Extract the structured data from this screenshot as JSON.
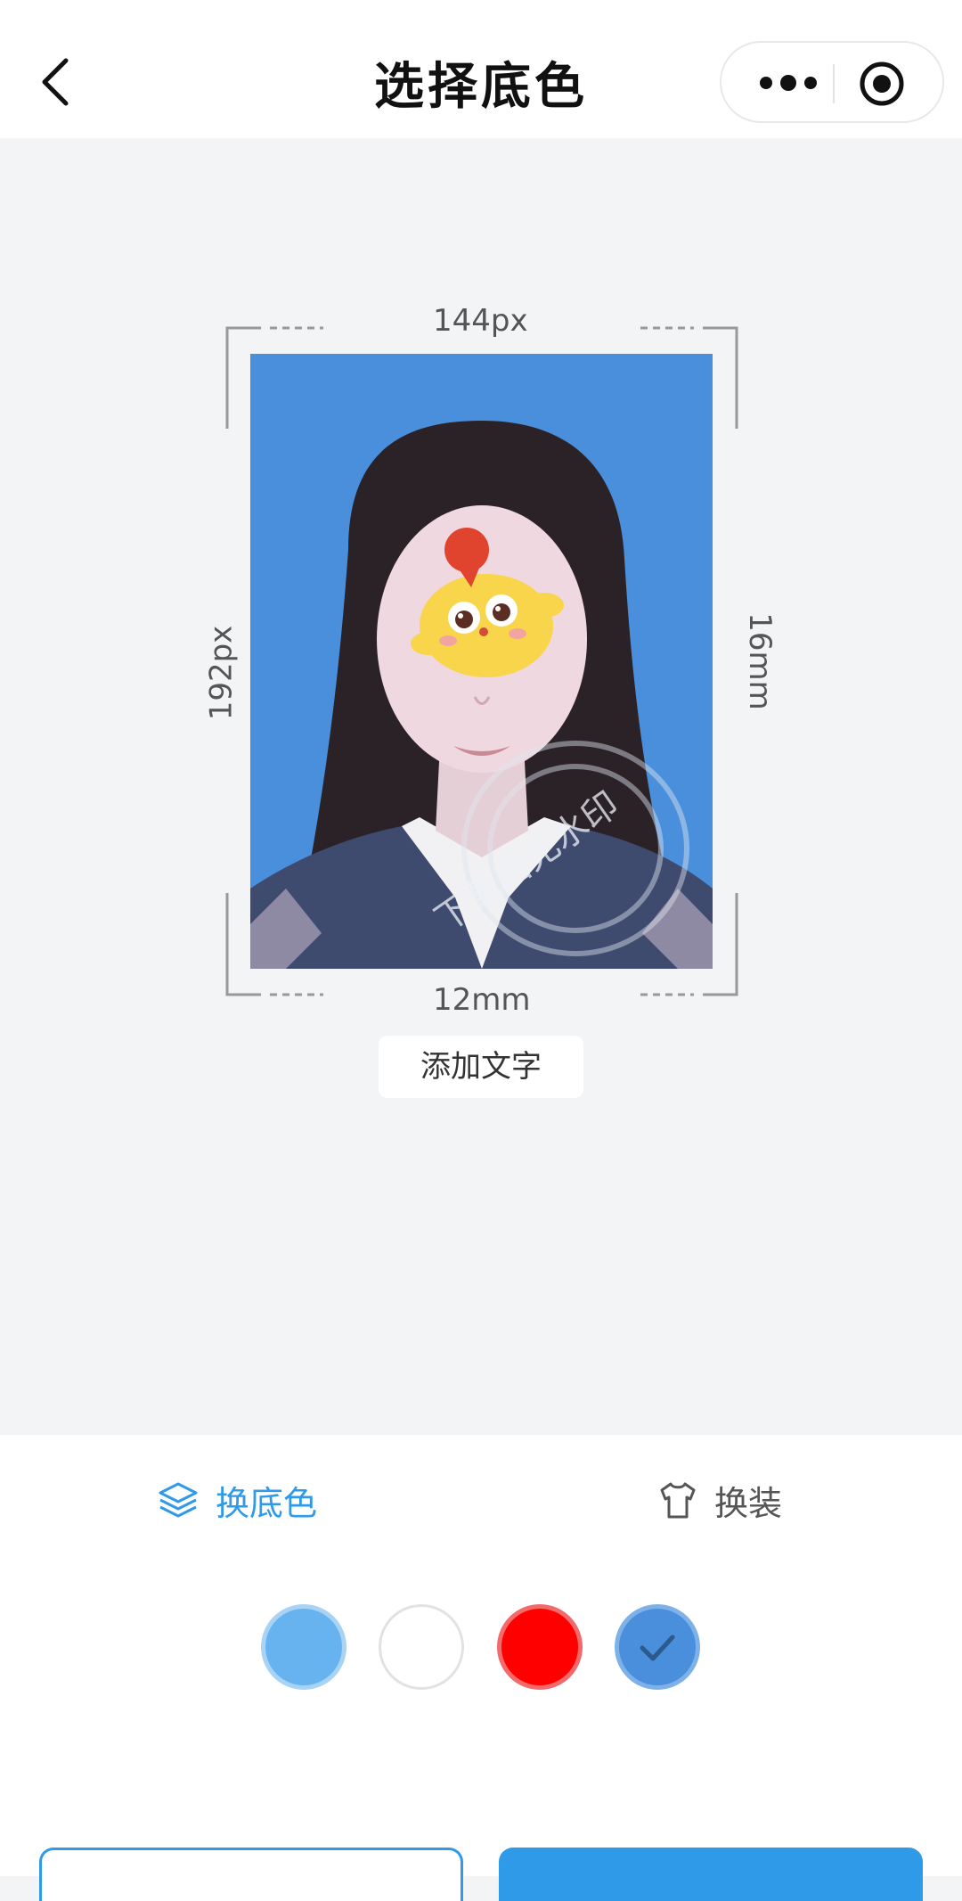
{
  "header": {
    "title": "选择底色"
  },
  "photo": {
    "width_label": "144px",
    "height_label": "192px",
    "height_mm_label": "16mm",
    "width_mm_label": "12mm",
    "watermark": "下载后无水印",
    "add_text_button": "添加文字"
  },
  "tabs": [
    {
      "label": "换底色",
      "icon": "layers-icon",
      "active": true
    },
    {
      "label": "换装",
      "icon": "shirt-icon",
      "active": false
    }
  ],
  "swatches": [
    {
      "color": "#66b3f0",
      "selected": false
    },
    {
      "color": "#ffffff",
      "selected": false
    },
    {
      "color": "#ff0000",
      "selected": false
    },
    {
      "color": "#4a8fdb",
      "selected": true
    }
  ],
  "colors": {
    "accent": "#2f9be8",
    "photo_background": "#4a8fdb"
  }
}
